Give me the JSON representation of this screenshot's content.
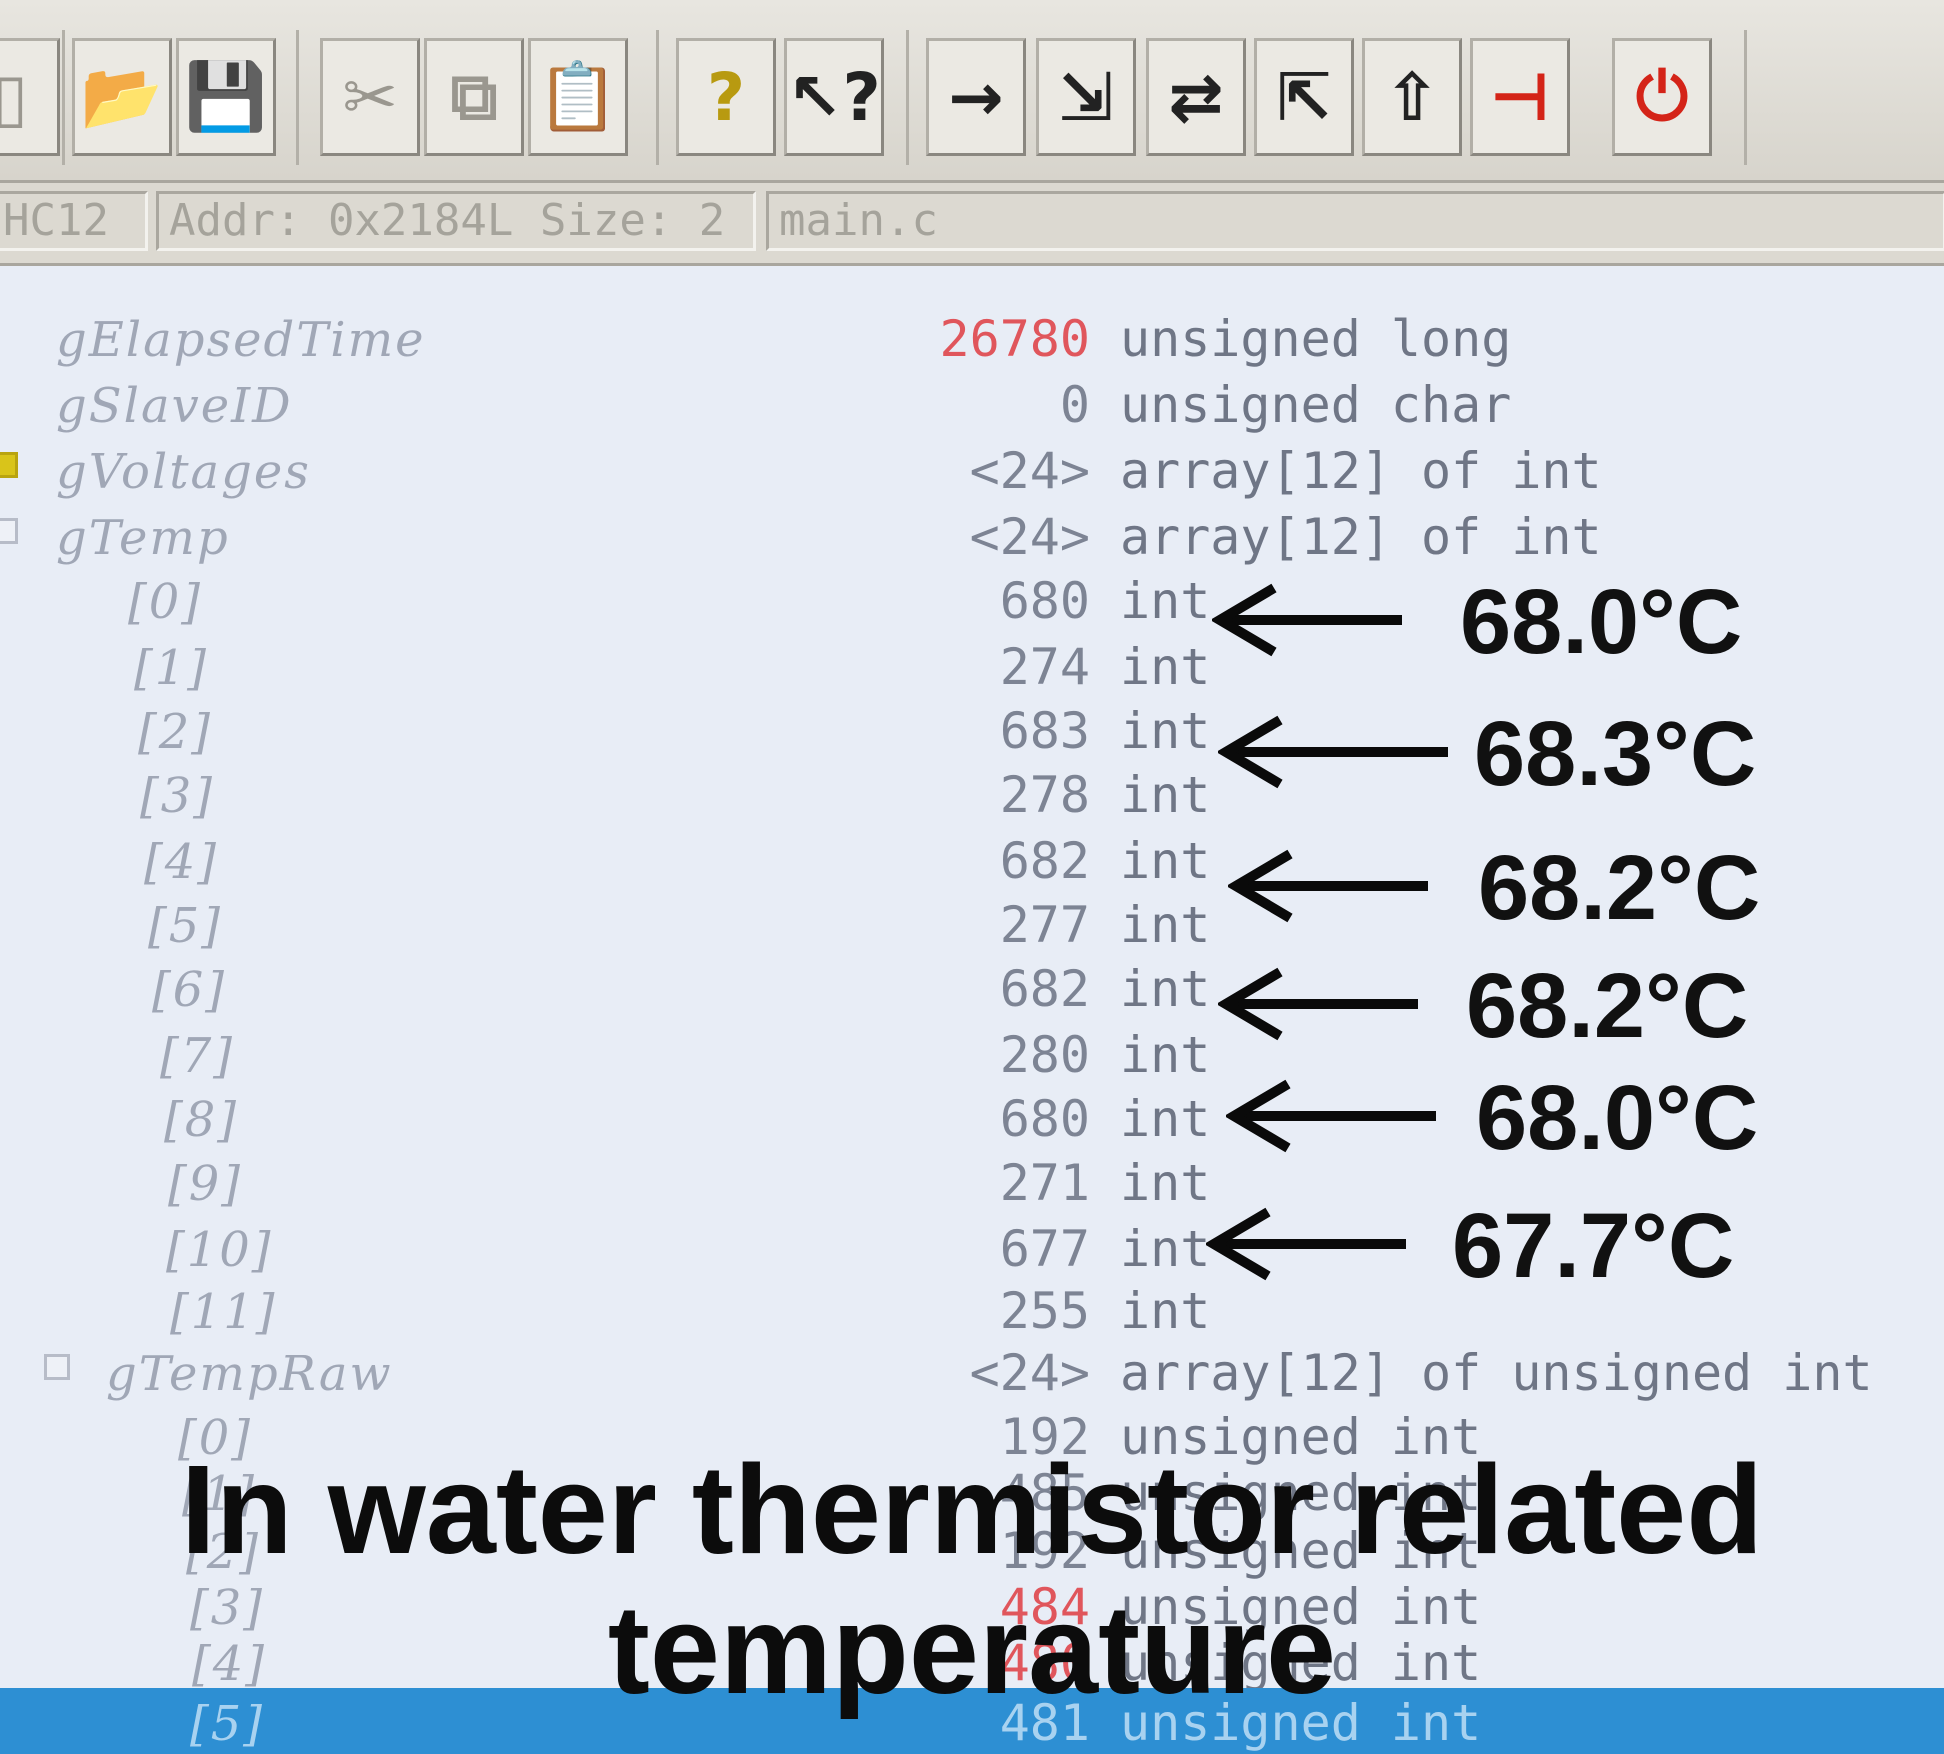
{
  "toolbar": {
    "buttons": [
      {
        "icon": "open-folder-icon",
        "glyph": "📂"
      },
      {
        "icon": "save-disk-icon",
        "glyph": "💾"
      },
      {
        "icon": "cut-icon",
        "glyph": "✂"
      },
      {
        "icon": "copy-icon",
        "glyph": "⧉"
      },
      {
        "icon": "paste-icon",
        "glyph": "📋"
      },
      {
        "icon": "help-icon",
        "glyph": "?"
      },
      {
        "icon": "context-help-icon",
        "glyph": "↖?"
      },
      {
        "icon": "go-icon",
        "glyph": "→"
      },
      {
        "icon": "step-into-icon",
        "glyph": "⇲"
      },
      {
        "icon": "step-over-icon",
        "glyph": "⇄"
      },
      {
        "icon": "step-out-icon",
        "glyph": "⇱"
      },
      {
        "icon": "step-up-icon",
        "glyph": "⇧"
      },
      {
        "icon": "run-to-cursor-icon",
        "glyph": "⊣"
      },
      {
        "icon": "reset-icon",
        "glyph": "⏻"
      }
    ]
  },
  "statusbar": {
    "symbol": "HC12",
    "address": "Addr: 0x2184L Size: 2",
    "file": "main.c"
  },
  "watch": {
    "rows": [
      {
        "name": "gElapsedTime",
        "value": "26780",
        "type": "unsigned long",
        "value_color": "#e0565c"
      },
      {
        "name": "gSlaveID",
        "value": "0",
        "type": "unsigned char"
      },
      {
        "name": "gVoltages",
        "value": "<24>",
        "type": "array[12] of int"
      },
      {
        "name": "gTemp",
        "value": "<24>",
        "type": "array[12] of int"
      },
      {
        "name": "[0]",
        "value": "680",
        "type": "int"
      },
      {
        "name": "[1]",
        "value": "274",
        "type": "int"
      },
      {
        "name": "[2]",
        "value": "683",
        "type": "int"
      },
      {
        "name": "[3]",
        "value": "278",
        "type": "int"
      },
      {
        "name": "[4]",
        "value": "682",
        "type": "int"
      },
      {
        "name": "[5]",
        "value": "277",
        "type": "int"
      },
      {
        "name": "[6]",
        "value": "682",
        "type": "int"
      },
      {
        "name": "[7]",
        "value": "280",
        "type": "int"
      },
      {
        "name": "[8]",
        "value": "680",
        "type": "int"
      },
      {
        "name": "[9]",
        "value": "271",
        "type": "int"
      },
      {
        "name": "[10]",
        "value": "677",
        "type": "int"
      },
      {
        "name": "[11]",
        "value": "255",
        "type": "int"
      },
      {
        "name": "gTempRaw",
        "value": "<24>",
        "type": "array[12] of unsigned int"
      },
      {
        "name": "[0]",
        "value": "192",
        "type": "unsigned int"
      },
      {
        "name": "[1]",
        "value": "485",
        "type": "unsigned int"
      },
      {
        "name": "[2]",
        "value": "192",
        "type": "unsigned int"
      },
      {
        "name": "[3]",
        "value": "484",
        "type": "unsigned int",
        "value_color": "#e0565c"
      },
      {
        "name": "[4]",
        "value": "480",
        "type": "unsigned int",
        "value_color": "#e0565c"
      },
      {
        "name": "[5]",
        "value": "481",
        "type": "unsigned int"
      }
    ]
  },
  "annotations": [
    {
      "label": "68.0°C"
    },
    {
      "label": "68.3°C"
    },
    {
      "label": "68.2°C"
    },
    {
      "label": "68.2°C"
    },
    {
      "label": "68.0°C"
    },
    {
      "label": "67.7°C"
    }
  ],
  "caption": {
    "line1": "In water thermistor related",
    "line2": "temperature"
  }
}
